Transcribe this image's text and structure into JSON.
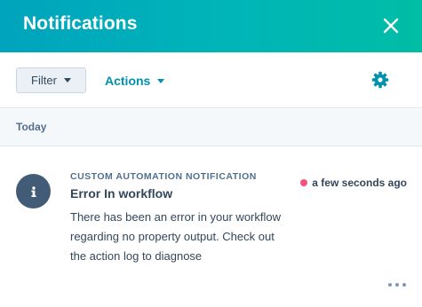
{
  "header": {
    "title": "Notifications",
    "close_icon": "close-icon",
    "gradient": [
      "#00a4bd",
      "#00bda5"
    ]
  },
  "toolbar": {
    "filter_label": "Filter",
    "actions_label": "Actions",
    "settings_icon": "gear-icon",
    "accent": "#0091ae"
  },
  "sections": [
    {
      "label": "Today",
      "notifications": [
        {
          "type": "CUSTOM AUTOMATION NOTIFICATION",
          "title": "Error In workflow",
          "body": "There has been an error in your workflow regarding no property output. Check out the action log to diagnose",
          "time": "a few seconds ago",
          "unread": true,
          "unread_color": "#f2547d",
          "icon": "info-icon",
          "more_icon": "more-icon"
        }
      ]
    }
  ]
}
